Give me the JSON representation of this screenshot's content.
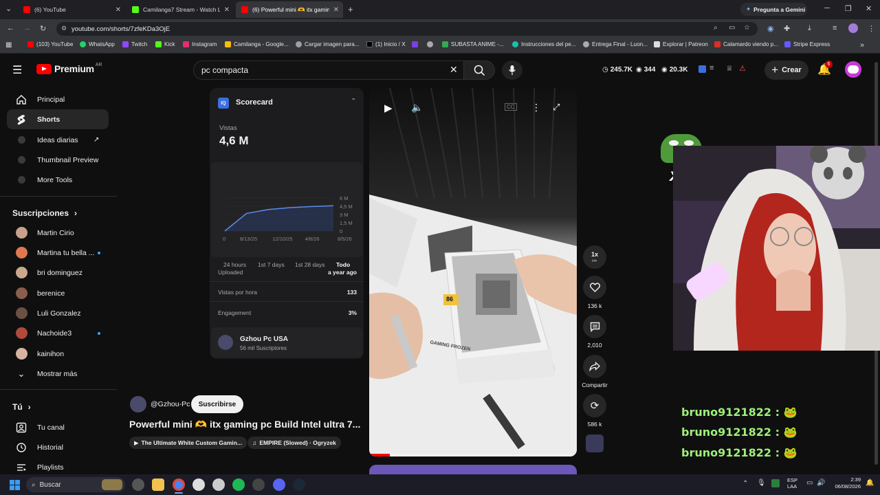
{
  "browser": {
    "tabs": [
      {
        "title": "(6) YouTube"
      },
      {
        "title": "Camilanga7 Stream - Watch Liv"
      },
      {
        "title": "(6) Powerful mini 🫶 itx gamin"
      }
    ],
    "gemini_label": "Pregunta a Gemini",
    "url": "youtube.com/shorts/7zfeKDa3OjE",
    "bookmarks": [
      {
        "label": "(103) YouTube"
      },
      {
        "label": "WhatsApp"
      },
      {
        "label": "Twitch"
      },
      {
        "label": "Kick"
      },
      {
        "label": "Instagram"
      },
      {
        "label": "Camilanga - Google..."
      },
      {
        "label": "Cargar imagen para..."
      },
      {
        "label": "(1) Inicio / X"
      },
      {
        "label": ""
      },
      {
        "label": ""
      },
      {
        "label": "SUBASTA ANIME -..."
      },
      {
        "label": "Instrucciones del pe..."
      },
      {
        "label": "Entrega Final - Luon..."
      },
      {
        "label": "Explorar | Patreon"
      },
      {
        "label": "Calamardo viendo p..."
      },
      {
        "label": "Stripe Express"
      }
    ]
  },
  "youtube": {
    "logo_text": "Premium",
    "region": "AR",
    "search_value": "pc compacta",
    "header_stats": {
      "views_a": "245.7K",
      "views_b": "344",
      "views_c": "20.3K"
    },
    "create_label": "Crear",
    "notification_count": "6",
    "sidebar": {
      "main": [
        {
          "label": "Principal"
        },
        {
          "label": "Shorts"
        },
        {
          "label": "Ideas diarias"
        },
        {
          "label": "Thumbnail Preview"
        },
        {
          "label": "More Tools"
        }
      ],
      "subs_title": "Suscripciones",
      "subs": [
        {
          "label": "Martin Cirio",
          "color": "#c9a08a",
          "new": false
        },
        {
          "label": "Martina tu bella ...",
          "color": "#e0784f",
          "new": true
        },
        {
          "label": "bri dominguez",
          "color": "#caa88e",
          "new": false
        },
        {
          "label": "berenice",
          "color": "#8a5d4c",
          "new": false
        },
        {
          "label": "Luli Gonzalez",
          "color": "#6b5046",
          "new": false
        },
        {
          "label": "Nachoide3",
          "color": "#b04a3a",
          "new": true
        },
        {
          "label": "kainihon",
          "color": "#d6b3a2",
          "new": false
        }
      ],
      "show_more": "Mostrar más",
      "you_title": "Tú",
      "you_items": [
        {
          "label": "Tu canal"
        },
        {
          "label": "Historial"
        },
        {
          "label": "Playlists"
        }
      ]
    },
    "scorecard": {
      "title": "Scorecard",
      "views_label": "Vistas",
      "views_value": "4,6 M",
      "ranges": [
        "24 hours",
        "1st 7 days",
        "1st 28 days",
        "Todo"
      ],
      "selected_range": "Todo",
      "uploaded_label": "Uploaded",
      "uploaded_value": "a year ago",
      "vph_label": "Vistas por hora",
      "vph_value": "133",
      "engagement_label": "Engagement",
      "engagement_value": "3%",
      "channel_name": "Gzhou Pc USA",
      "channel_subs": "56 mil Suscriptores"
    },
    "chart_data": {
      "type": "line",
      "x": [
        "8/13/25",
        "12/10/25",
        "4/8/26",
        "8/5/26"
      ],
      "x_start_label": "0",
      "y_ticks": [
        "6 M",
        "4,5 M",
        "3 M",
        "1,5 M",
        "0"
      ],
      "ylim": [
        0,
        6000000
      ],
      "series": [
        {
          "values": [
            0,
            3200000,
            3900000,
            4250000,
            4450000,
            4600000
          ]
        }
      ]
    },
    "short": {
      "speed": "1x",
      "likes": "136 k",
      "comments": "2,010",
      "share_label": "Compartir",
      "remix_count": "586 k",
      "channel_handle": "@Gzhou-Pc",
      "subscribe_label": "Suscribirse",
      "title": "Powerful mini 🫶 itx gaming pc Build Intel ultra 7...",
      "chip_1": "The Ultimate White Custom Gamin...",
      "chip_2": "EMPIRE (Slowed) · Ogryzek",
      "box_text": "GAMING FROZEN",
      "ram_label": "86",
      "progress": 0.1
    }
  },
  "overlay": {
    "emote_text": "x3",
    "chat": [
      {
        "line": "bruno9121822 : 🐸"
      },
      {
        "line": "bruno9121822 : 🐸"
      },
      {
        "line": "bruno9121822 : 🐸"
      }
    ]
  },
  "taskbar": {
    "search_placeholder": "Buscar",
    "lang_1": "ESP",
    "lang_2": "LAA",
    "time": "2:39",
    "date": "06/08/2026"
  }
}
